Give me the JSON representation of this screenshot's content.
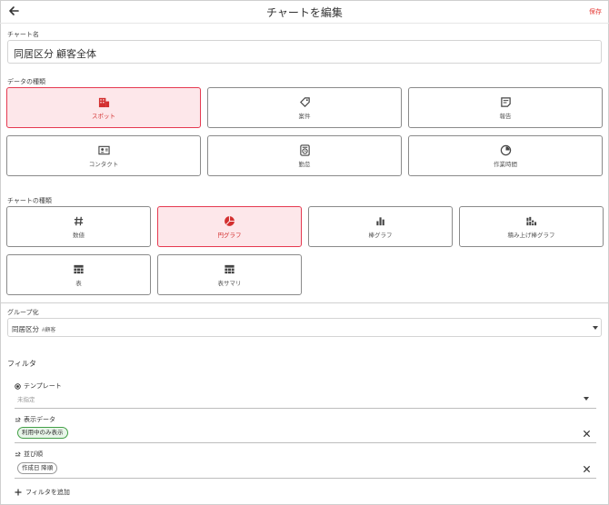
{
  "header": {
    "title": "チャートを編集",
    "save_label": "保存",
    "back_icon": "arrow-left-icon"
  },
  "chart_name": {
    "label": "チャート名",
    "value": "同居区分 顧客全体"
  },
  "data_type": {
    "label": "データの種類",
    "items": [
      {
        "label": "スポット",
        "icon": "building-icon",
        "selected": true
      },
      {
        "label": "案件",
        "icon": "tag-icon",
        "selected": false
      },
      {
        "label": "報告",
        "icon": "note-icon",
        "selected": false
      },
      {
        "label": "コンタクト",
        "icon": "contact-card-icon",
        "selected": false
      },
      {
        "label": "勤怠",
        "icon": "timeclock-icon",
        "selected": false
      },
      {
        "label": "作業時間",
        "icon": "clock-icon",
        "selected": false
      }
    ]
  },
  "chart_type": {
    "label": "チャートの種類",
    "items": [
      {
        "label": "数値",
        "icon": "hash-icon",
        "selected": false
      },
      {
        "label": "円グラフ",
        "icon": "pie-chart-icon",
        "selected": true
      },
      {
        "label": "棒グラフ",
        "icon": "bar-chart-icon",
        "selected": false
      },
      {
        "label": "積み上げ棒グラフ",
        "icon": "stacked-bar-icon",
        "selected": false
      },
      {
        "label": "表",
        "icon": "table-icon",
        "selected": false
      },
      {
        "label": "表サマリ",
        "icon": "table-summary-icon",
        "selected": false
      }
    ]
  },
  "grouping": {
    "label": "グループ化",
    "value": "同居区分",
    "tag": "#顧客"
  },
  "filter": {
    "title": "フィルタ",
    "template": {
      "label": "テンプレート",
      "placeholder": "未指定"
    },
    "display_data": {
      "label": "表示データ",
      "chip": "利用中のみ表示"
    },
    "sort": {
      "label": "並び順",
      "chip": "作成日 降順"
    },
    "add_label": "フィルタを追加"
  },
  "colors": {
    "accent": "#e53950",
    "selected_bg": "#fde7ea",
    "chip_green": "#43a047"
  }
}
